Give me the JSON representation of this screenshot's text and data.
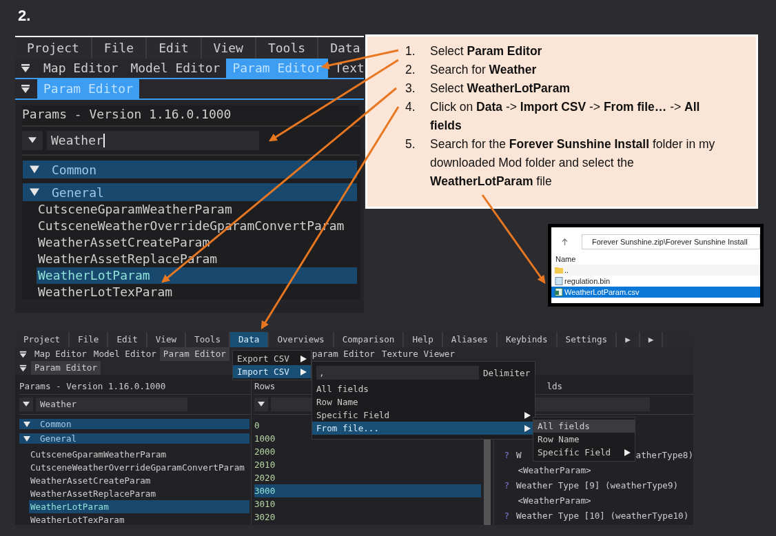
{
  "heading": "2.",
  "top_screenshot": {
    "menu": [
      {
        "label": "Project",
        "selected": false
      },
      {
        "label": "File",
        "selected": false
      },
      {
        "label": "Edit",
        "selected": false
      },
      {
        "label": "View",
        "selected": false
      },
      {
        "label": "Tools",
        "selected": false
      },
      {
        "label": "Data",
        "selected": false
      }
    ],
    "tabs": [
      {
        "label": "Map Editor",
        "selected": false
      },
      {
        "label": "Model Editor",
        "selected": false
      },
      {
        "label": "Param Editor",
        "selected": true
      },
      {
        "label": "Text",
        "selected": false
      }
    ],
    "panel_tab": {
      "label": "Param Editor",
      "selected": true
    },
    "params_title": "Params - Version 1.16.0.1000",
    "search": {
      "value": "Weather",
      "focused": true
    },
    "groups": [
      {
        "label": "Common",
        "expanded": true
      },
      {
        "label": "General",
        "expanded": true
      }
    ],
    "items": [
      {
        "label": "CutsceneGparamWeatherParam",
        "selected": false
      },
      {
        "label": "CutsceneWeatherOverrideGparamConvertParam",
        "selected": false
      },
      {
        "label": "WeatherAssetCreateParam",
        "selected": false
      },
      {
        "label": "WeatherAssetReplaceParam",
        "selected": false
      },
      {
        "label": "WeatherLotParam",
        "selected": true
      },
      {
        "label": "WeatherLotTexParam",
        "selected": false
      }
    ]
  },
  "instructions": [
    {
      "number": "1.",
      "text": "Select **Param Editor**"
    },
    {
      "number": "2.",
      "text": "Search for **Weather**"
    },
    {
      "number": "3.",
      "text": "Select **WeatherLotParam**"
    },
    {
      "number": "4.",
      "text": "Click on **Data** -> **Import CSV** -> **From file…** -> **All fields**"
    },
    {
      "number": "5.",
      "text": "Search for the **Forever Sunshine Install** folder in my downloaded Mod folder and select the **WeatherLotParam** file"
    }
  ],
  "file_browser": {
    "address": "Forever Sunshine.zip\\Forever Sunshine Install",
    "column": "Name",
    "files": [
      {
        "name": "..",
        "kind": "folder",
        "selected": false
      },
      {
        "name": "regulation.bin",
        "kind": "file",
        "selected": false
      },
      {
        "name": "WeatherLotParam.csv",
        "kind": "spreadsheet",
        "selected": true
      }
    ]
  },
  "bottom_screenshot": {
    "menu": [
      {
        "label": "Project",
        "selected": false
      },
      {
        "label": "File",
        "selected": false
      },
      {
        "label": "Edit",
        "selected": false
      },
      {
        "label": "View",
        "selected": false
      },
      {
        "label": "Tools",
        "selected": false
      },
      {
        "label": "Data",
        "selected": true
      },
      {
        "label": "Overviews",
        "selected": false
      },
      {
        "label": "Comparison",
        "selected": false
      },
      {
        "label": "Help",
        "selected": false
      },
      {
        "label": "Aliases",
        "selected": false
      },
      {
        "label": "Keybinds",
        "selected": false
      },
      {
        "label": "Settings",
        "selected": false
      },
      {
        "label": "▶",
        "selected": false
      },
      {
        "label": "▶",
        "selected": false
      }
    ],
    "tabs": [
      {
        "label": "Map Editor",
        "selected": false
      },
      {
        "label": "Model Editor",
        "selected": false
      },
      {
        "label": "Param Editor",
        "selected": true
      },
      {
        "label": "param Editor",
        "selected": false
      },
      {
        "label": "Texture Viewer",
        "selected": false
      }
    ],
    "panel_tab": {
      "label": "Param Editor",
      "selected": true
    },
    "params_title": "Params - Version 1.16.0.1000",
    "rows_title": "Rows",
    "fields_title": "lds",
    "search": {
      "value": "Weather",
      "focused": false
    },
    "groups": [
      {
        "label": "Common",
        "expanded": true
      },
      {
        "label": "General",
        "expanded": true
      }
    ],
    "items": [
      {
        "label": "CutsceneGparamWeatherParam",
        "selected": false
      },
      {
        "label": "CutsceneWeatherOverrideGparamConvertParam",
        "selected": false
      },
      {
        "label": "WeatherAssetCreateParam",
        "selected": false
      },
      {
        "label": "WeatherAssetReplaceParam",
        "selected": false
      },
      {
        "label": "WeatherLotParam",
        "selected": true
      },
      {
        "label": "WeatherLotTexParam",
        "selected": false
      }
    ],
    "rows": [
      {
        "label": "0",
        "selected": false
      },
      {
        "label": "1000",
        "selected": false
      },
      {
        "label": "2000",
        "selected": false
      },
      {
        "label": "2010",
        "selected": false
      },
      {
        "label": "2020",
        "selected": false
      },
      {
        "label": "3000",
        "selected": true
      },
      {
        "label": "3010",
        "selected": false
      },
      {
        "label": "3020",
        "selected": false
      }
    ],
    "fields": [
      {
        "kind": "field",
        "help": "?",
        "text": "W",
        "tail": "atherType8)"
      },
      {
        "kind": "type",
        "text": "<WeatherParam>"
      },
      {
        "kind": "field",
        "help": "?",
        "text": "Weather Type [9] (weatherType9)"
      },
      {
        "kind": "type",
        "text": "<WeatherParam>"
      },
      {
        "kind": "field",
        "help": "?",
        "text": "Weather Type [10] (weatherType10)"
      }
    ],
    "data_menu": [
      {
        "label": "Export CSV",
        "selected": false,
        "submenu": true
      },
      {
        "label": "Import CSV",
        "selected": true,
        "submenu": true
      }
    ],
    "import_menu": {
      "delimiter": {
        "value": ",",
        "label": "Delimiter"
      },
      "items": [
        {
          "label": "All fields",
          "selected": false,
          "submenu": false
        },
        {
          "label": "Row Name",
          "selected": false,
          "submenu": false
        },
        {
          "label": "Specific Field",
          "selected": false,
          "submenu": true
        },
        {
          "label": "From file...",
          "selected": true,
          "submenu": true
        }
      ]
    },
    "file_menu": [
      {
        "label": "All fields",
        "selected": true,
        "submenu": false
      },
      {
        "label": "Row Name",
        "selected": false,
        "submenu": false
      },
      {
        "label": "Specific Field",
        "selected": false,
        "submenu": true
      }
    ]
  }
}
